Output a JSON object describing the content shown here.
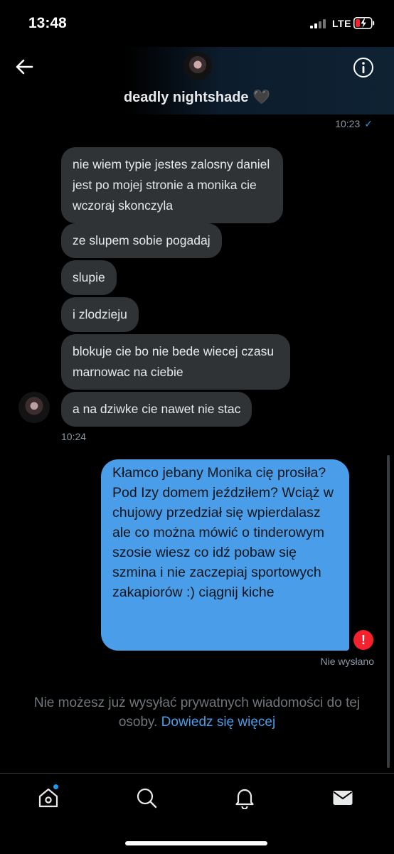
{
  "status_bar": {
    "time": "13:48",
    "network": "LTE"
  },
  "header": {
    "contact_name": "deadly nightshade 🖤",
    "back_icon": "arrow-left-icon",
    "info_icon": "info-icon"
  },
  "conversation": {
    "previous_time": "10:23",
    "previous_status": "✓",
    "received": [
      "nie wiem typie jestes zalosny daniel jest po mojej stronie a monika cie wczoraj skonczyla",
      "ze slupem sobie pogadaj",
      "slupie",
      "i zlodzieju",
      "blokuje cie bo nie bede wiecej czasu marnowac na ciebie",
      "a na dziwke cie nawet nie stac"
    ],
    "received_time": "10:24",
    "sent": "Kłamco jebany Monika cię prosiła? Pod Izy domem jeździłem? Wciąż w chujowy przedział się wpierdalasz ale co można mówić o tinderowym szosie wiesz co idź pobaw się szmina i nie zaczepiaj sportowych zakapiorów :) ciągnij kiche",
    "sent_status": "Nie wysłano",
    "error_badge": "!"
  },
  "notice": {
    "text": "Nie możesz już wysyłać prywatnych wiadomości do tej osoby.",
    "link": "Dowiedz się więcej"
  },
  "nav": {
    "items": [
      "home-icon",
      "search-icon",
      "notifications-icon",
      "messages-icon"
    ]
  },
  "colors": {
    "sent_bubble": "#4a9ee9",
    "received_bubble": "#2f3336",
    "accent": "#1d9bf0",
    "error": "#f4212e"
  }
}
